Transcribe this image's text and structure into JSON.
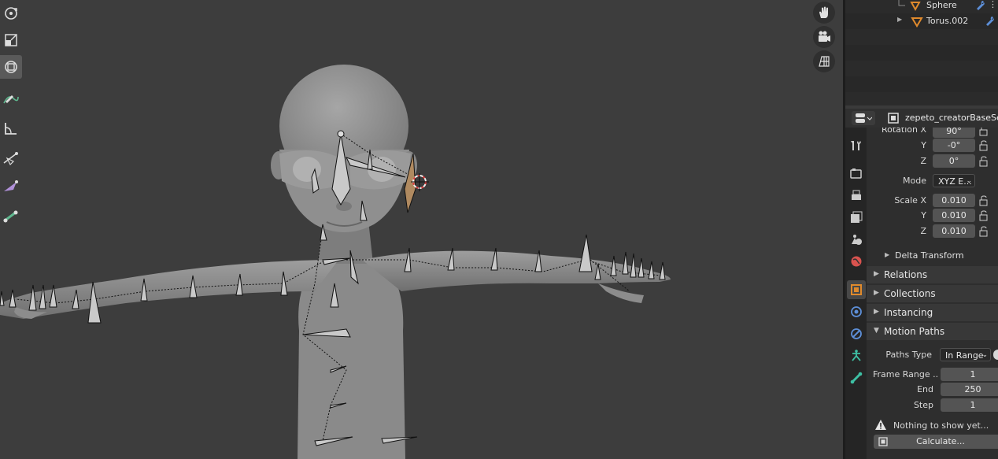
{
  "outliner": {
    "items": [
      {
        "name": "Sphere"
      },
      {
        "name": "Torus.002"
      }
    ]
  },
  "properties_header": {
    "object_name": "zepeto_creatorBaseSet"
  },
  "transform": {
    "rotation_x_label": "Rotation X",
    "rotation_x": "90°",
    "y_label": "Y",
    "rotation_y": "-0°",
    "z_label": "Z",
    "rotation_z": "0°",
    "mode_label": "Mode",
    "mode_value": "XYZ E...",
    "scale_x_label": "Scale X",
    "scale_x": "0.010",
    "scale_y": "0.010",
    "scale_z": "0.010"
  },
  "panels": {
    "delta_transform": "Delta Transform",
    "relations": "Relations",
    "collections": "Collections",
    "instancing": "Instancing",
    "motion_paths": "Motion Paths"
  },
  "motion_paths": {
    "paths_type_label": "Paths Type",
    "paths_type_value": "In Range",
    "frame_range_label": "Frame Range ..",
    "frame_start": "1",
    "end_label": "End",
    "frame_end": "250",
    "step_label": "Step",
    "step": "1",
    "warning": "Nothing to show yet...",
    "calculate_label": "Calculate..."
  },
  "colors": {
    "viewport_bg": "#3d3d3d",
    "panel_bg": "#2e2e2e",
    "object_orange": "#e08a2c",
    "constraint_teal": "#3ec0a4",
    "world_red": "#d9534f"
  },
  "icons": {
    "viewport_tools": [
      "rotate-icon",
      "scale-icon",
      "transform-icon",
      "annotate-icon",
      "measure-icon",
      "bone-envelope-icon",
      "bone-size-icon",
      "extrude-icon"
    ],
    "navigation": [
      "hand-pan-icon",
      "camera-view-icon",
      "ortho-grid-icon"
    ],
    "property_tabs": [
      "tool-icon",
      "render-icon",
      "output-icon",
      "view-layer-icon",
      "scene-icon",
      "world-icon",
      "object-icon",
      "modifier-icon",
      "physics-icon",
      "constraint-icon",
      "data-bone-icon"
    ]
  }
}
